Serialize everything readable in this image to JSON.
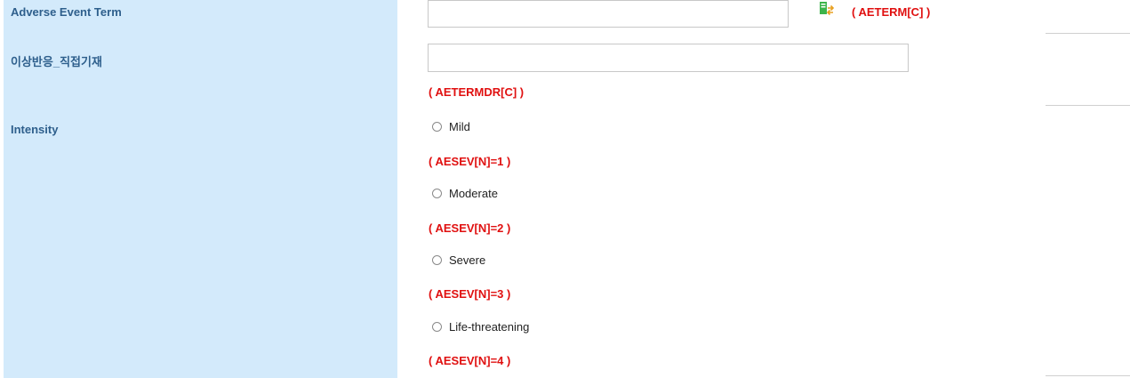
{
  "fields": {
    "ae_term": {
      "label": "Adverse Event Term",
      "value": "",
      "code": "( AETERM[C] )"
    },
    "ae_term_direct": {
      "label": "이상반응_직접기재",
      "value": "",
      "code": "( AETERMDR[C] )"
    },
    "intensity": {
      "label": "Intensity",
      "options": [
        {
          "label": "Mild",
          "code": "( AESEV[N]=1 )"
        },
        {
          "label": "Moderate",
          "code": "( AESEV[N]=2 )"
        },
        {
          "label": "Severe",
          "code": "( AESEV[N]=3 )"
        },
        {
          "label": "Life-threatening",
          "code": "( AESEV[N]=4 )"
        }
      ]
    }
  },
  "icons": {
    "lookup": "dictionary-lookup-icon"
  },
  "colors": {
    "label_bg": "#d3eafb",
    "label_text": "#2e5f8c",
    "code_text": "#e01010",
    "icon_green": "#3cb44b"
  }
}
